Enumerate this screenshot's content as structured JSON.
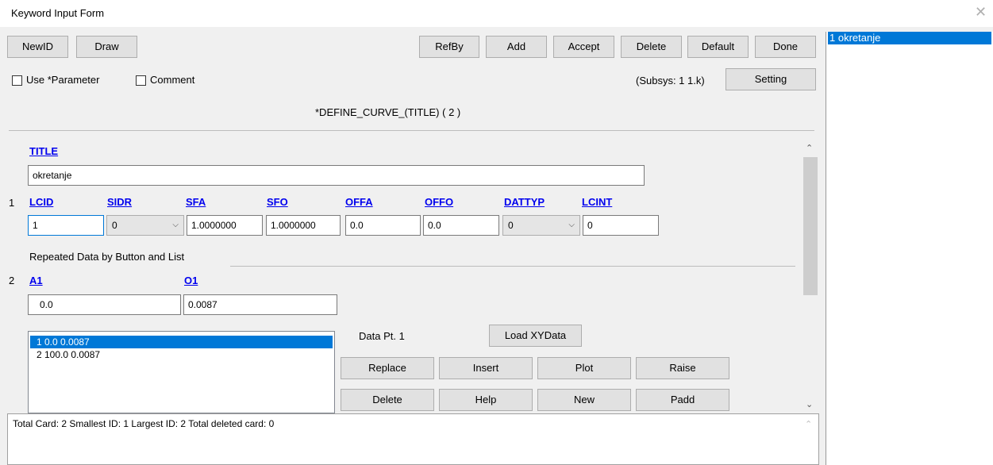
{
  "window": {
    "title": "Keyword Input Form",
    "close_glyph": "✕"
  },
  "toolbar": {
    "left": [
      "NewID",
      "Draw"
    ],
    "right": [
      "RefBy",
      "Add",
      "Accept",
      "Delete",
      "Default",
      "Done"
    ]
  },
  "options": {
    "use_parameter": "Use *Parameter",
    "comment": "Comment",
    "subsys": "(Subsys: 1 1.k)",
    "setting": "Setting"
  },
  "keyword_header": "*DEFINE_CURVE_(TITLE)   ( 2 )",
  "title_field": {
    "label": "TITLE",
    "value": "okretanje"
  },
  "card1": {
    "row_num": "1",
    "labels": [
      "LCID",
      "SIDR",
      "SFA",
      "SFO",
      "OFFA",
      "OFFO",
      "DATTYP",
      "LCINT"
    ],
    "values": {
      "lcid": "1",
      "sidr": "0",
      "sfa": "1.0000000",
      "sfo": "1.0000000",
      "offa": "0.0",
      "offo": "0.0",
      "dattyp": "0",
      "lcint": "0"
    }
  },
  "repeated_label": "Repeated Data by Button and List",
  "card2": {
    "row_num": "2",
    "a1_label": "A1",
    "o1_label": "O1",
    "a1_value": "0.0",
    "o1_value": "0.0087"
  },
  "data_list": [
    {
      "text": "1   0.0 0.0087",
      "selected": true
    },
    {
      "text": "2  100.0 0.0087",
      "selected": false
    }
  ],
  "data_pt": "Data Pt.  1",
  "load_xydata": "Load XYData",
  "list_buttons": {
    "row1": [
      "Replace",
      "Insert",
      "Plot",
      "Raise"
    ],
    "row2": [
      "Delete",
      "Help",
      "New",
      "Padd"
    ]
  },
  "status": "Total Card: 2   Smallest ID: 1   Largest ID: 2   Total deleted card:  0",
  "right_panel": {
    "item": "1  okretanje"
  },
  "colors": {
    "selection": "#0078d7",
    "link": "#0000ee"
  }
}
